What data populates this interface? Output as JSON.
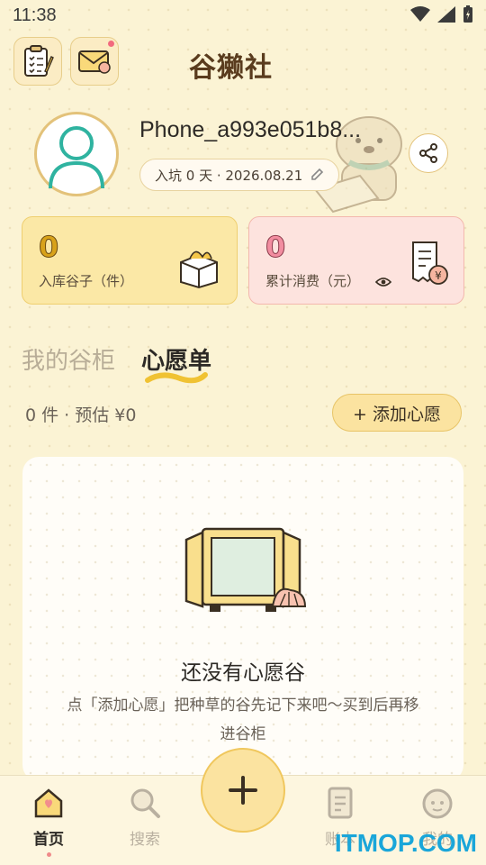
{
  "status_bar": {
    "time": "11:38"
  },
  "header": {
    "app_title": "谷獭社"
  },
  "profile": {
    "username": "Phone_a993e051b8...",
    "join_text": "入坑 0 天 · 2026.08.21"
  },
  "stats": {
    "stored_value": "0",
    "stored_label": "入库谷子（件）",
    "spent_value": "0",
    "spent_label": "累计消费（元）"
  },
  "tabs": {
    "my_cabinet": "我的谷柜",
    "wishlist": "心愿单"
  },
  "wishlist": {
    "summary": "0 件 · 预估 ¥0",
    "add_button": "+ 添加心愿",
    "empty_title": "还没有心愿谷",
    "empty_desc": "点「添加心愿」把种草的谷先记下来吧～买到后再移进谷柜"
  },
  "bottom_nav": {
    "home": "首页",
    "search": "搜索",
    "ledger": "账本",
    "mine": "我的"
  },
  "watermark": "ITMOP.COM",
  "colors": {
    "accent": "#f0c75d",
    "pink": "#f28da0",
    "background": "#fbf3d4"
  }
}
